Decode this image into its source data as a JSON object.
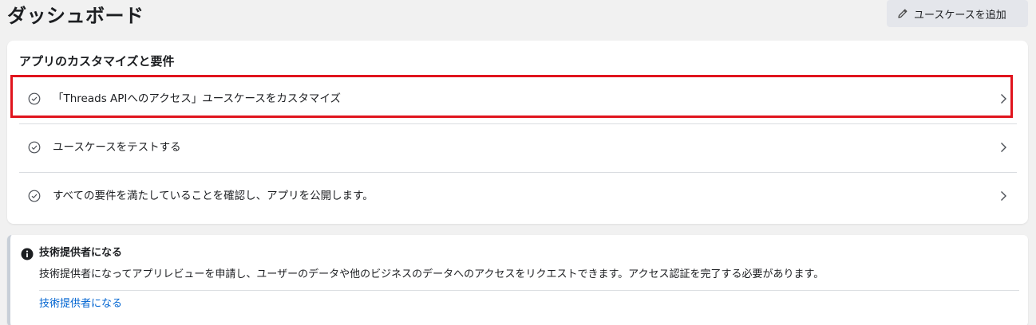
{
  "header": {
    "title": "ダッシュボード",
    "add_usecase_label": "ユースケースを追加"
  },
  "customize_card": {
    "title": "アプリのカスタマイズと要件",
    "steps": [
      {
        "label": "「Threads APIへのアクセス」ユースケースをカスタマイズ",
        "highlighted": true
      },
      {
        "label": "ユースケースをテストする",
        "highlighted": false
      },
      {
        "label": "すべての要件を満たしていることを確認し、アプリを公開します。",
        "highlighted": false
      }
    ]
  },
  "tech_provider_card": {
    "title": "技術提供者になる",
    "body": "技術提供者になってアプリレビューを申請し、ユーザーのデータや他のビジネスのデータへのアクセスをリクエストできます。アクセス認証を完了する必要があります。",
    "link": "技術提供者になる"
  },
  "colors": {
    "highlight": "#e0141d",
    "link": "#0064d1",
    "background": "#f1f1f1"
  },
  "icons": [
    "pencil-icon",
    "check-circle-icon",
    "chevron-right-icon",
    "info-icon"
  ]
}
